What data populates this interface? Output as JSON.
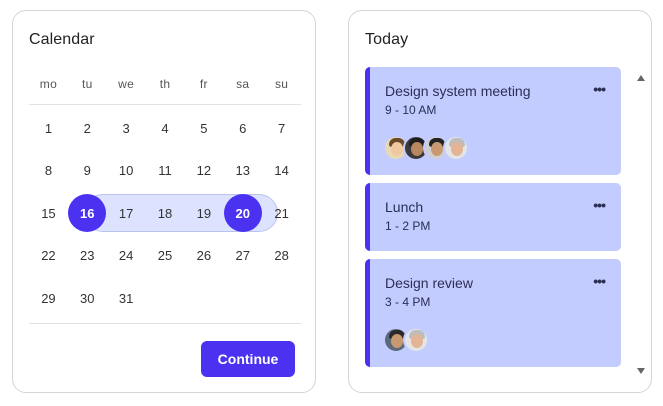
{
  "calendar": {
    "title": "Calendar",
    "weekdays": [
      "mo",
      "tu",
      "we",
      "th",
      "fr",
      "sa",
      "su"
    ],
    "weeks": [
      [
        "1",
        "2",
        "3",
        "4",
        "5",
        "6",
        "7"
      ],
      [
        "8",
        "9",
        "10",
        "11",
        "12",
        "13",
        "14"
      ],
      [
        "15",
        "16",
        "17",
        "18",
        "19",
        "20",
        "21"
      ],
      [
        "22",
        "23",
        "24",
        "25",
        "26",
        "27",
        "28"
      ],
      [
        "29",
        "30",
        "31",
        "",
        "",
        "",
        ""
      ]
    ],
    "range_start": "16",
    "range_end": "20",
    "continue_label": "Continue"
  },
  "today": {
    "title": "Today",
    "more_label": "•••",
    "events": [
      {
        "title": "Design system meeting",
        "time": "9 - 10 AM",
        "attendees": 4
      },
      {
        "title": "Lunch",
        "time": "1 - 2 PM",
        "attendees": 0
      },
      {
        "title": "Design review",
        "time": "3 - 4 PM",
        "attendees": 2
      }
    ]
  },
  "colors": {
    "accent": "#4a32f0",
    "range_fill": "#dde3ff",
    "event_bg": "#c3ccff"
  },
  "icons": {
    "more": "more-horizontal-icon",
    "scroll_up": "caret-up-icon",
    "scroll_down": "caret-down-icon"
  }
}
